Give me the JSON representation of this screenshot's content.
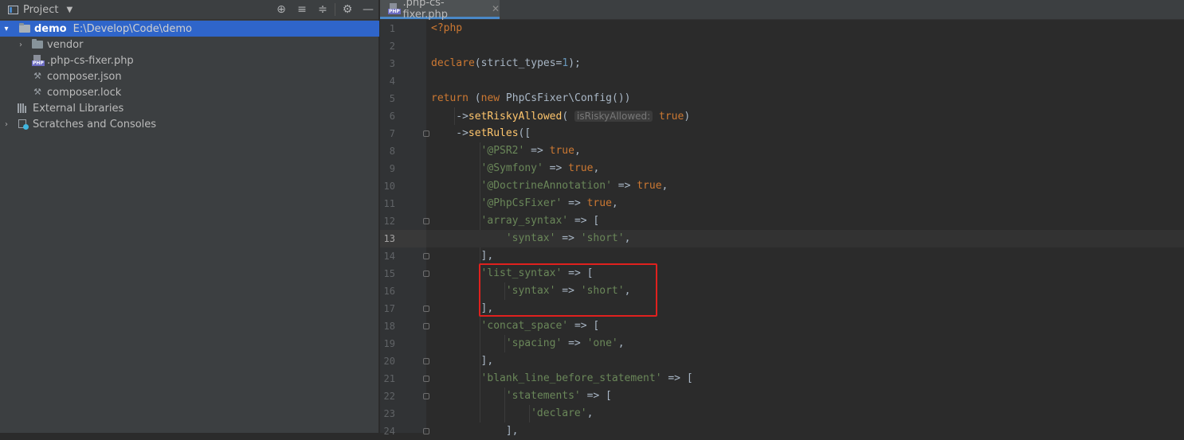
{
  "project_panel": {
    "title": "Project",
    "tree": [
      {
        "name": "demo",
        "path": "E:\\Develop\\Code\\demo",
        "type": "folder",
        "expanded": true,
        "selected": true
      },
      {
        "name": "vendor",
        "type": "folder",
        "expanded": false
      },
      {
        "name": ".php-cs-fixer.php",
        "type": "php-file"
      },
      {
        "name": "composer.json",
        "type": "json-file"
      },
      {
        "name": "composer.lock",
        "type": "lock-file"
      },
      {
        "name": "External Libraries",
        "type": "library"
      },
      {
        "name": "Scratches and Consoles",
        "type": "scratches",
        "expanded": false
      }
    ],
    "toolbar_icons": [
      "locate-icon",
      "expand-all-icon",
      "collapse-all-icon",
      "gear-icon",
      "hide-icon"
    ]
  },
  "editor": {
    "tab_label": ".php-cs-fixer.php",
    "current_line": 13,
    "lines": [
      {
        "n": "1",
        "text": "<?php"
      },
      {
        "n": "2",
        "text": ""
      },
      {
        "n": "3",
        "text": "declare(strict_types=1);"
      },
      {
        "n": "4",
        "text": ""
      },
      {
        "n": "5",
        "text": "return (new PhpCsFixer\\Config())"
      },
      {
        "n": "6",
        "text": "->setRiskyAllowed( isRiskyAllowed: true)"
      },
      {
        "n": "7",
        "text": "->setRules(["
      },
      {
        "n": "8",
        "text": "'@PSR2' => true,"
      },
      {
        "n": "9",
        "text": "'@Symfony' => true,"
      },
      {
        "n": "10",
        "text": "'@DoctrineAnnotation' => true,"
      },
      {
        "n": "11",
        "text": "'@PhpCsFixer' => true,"
      },
      {
        "n": "12",
        "text": "'array_syntax' => ["
      },
      {
        "n": "13",
        "text": "'syntax' => 'short',"
      },
      {
        "n": "14",
        "text": "],"
      },
      {
        "n": "15",
        "text": "'list_syntax' => ["
      },
      {
        "n": "16",
        "text": "'syntax' => 'short',"
      },
      {
        "n": "17",
        "text": "],"
      },
      {
        "n": "18",
        "text": "'concat_space' => ["
      },
      {
        "n": "19",
        "text": "'spacing' => 'one',"
      },
      {
        "n": "20",
        "text": "],"
      },
      {
        "n": "21",
        "text": "'blank_line_before_statement' => ["
      },
      {
        "n": "22",
        "text": "'statements' => ["
      },
      {
        "n": "23",
        "text": "'declare',"
      },
      {
        "n": "24",
        "text": "],"
      }
    ],
    "highlight_box_lines": [
      15,
      17
    ],
    "colors": {
      "keyword": "#cc7832",
      "string": "#6a8759",
      "number": "#6897bb",
      "function": "#ffc66d",
      "plain": "#a9b7c6",
      "highlight": "#e0211e",
      "selection": "#2f65ca"
    }
  }
}
